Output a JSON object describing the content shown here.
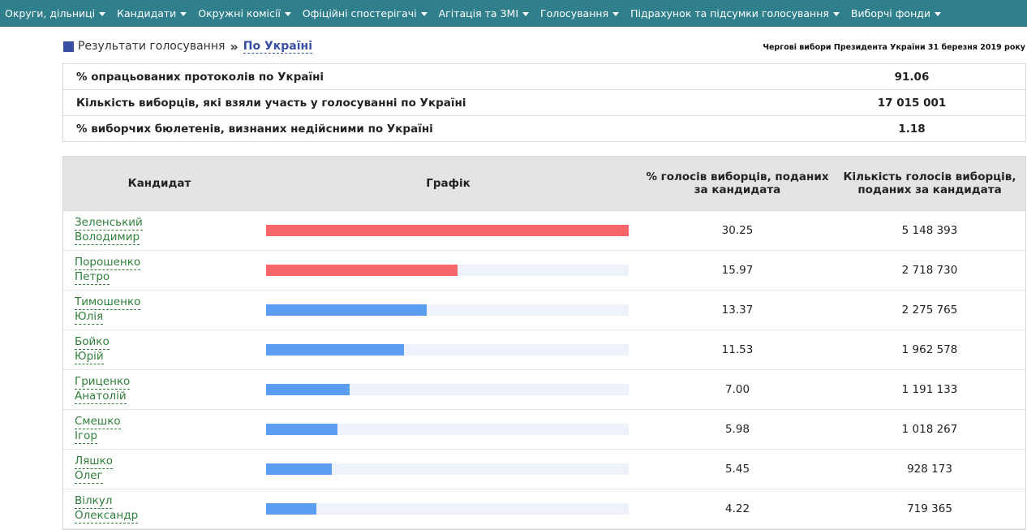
{
  "nav": [
    "Округи, дільниці",
    "Кандидати",
    "Окружні комісії",
    "Офіційні спостерігачі",
    "Агітація та ЗМІ",
    "Голосування",
    "Підрахунок та підсумки голосування",
    "Виборчі фонди"
  ],
  "breadcrumb": {
    "section": "Результати голосування",
    "separator": "»",
    "current": "По Україні"
  },
  "election_title": "Чергові вибори Президента України 31 березня 2019 року",
  "summary": [
    {
      "label": "% опрацьованих протоколів по Україні",
      "value": "91.06"
    },
    {
      "label": "Кількість виборців, які взяли участь у голосуванні по Україні",
      "value": "17 015 001"
    },
    {
      "label": "% виборчих бюлетенів, визнаних недійсними по Україні",
      "value": "1.18"
    }
  ],
  "table": {
    "headers": {
      "candidate": "Кандидат",
      "chart": "Графік",
      "pct": "% голосів виборців, поданих за кандидата",
      "votes": "Кількість голосів виборців, поданих за кандидата"
    },
    "rows": [
      {
        "surname": "Зеленський",
        "name": "Володимир",
        "pct": "30.25",
        "votes": "5 148 393",
        "share": 30.25
      },
      {
        "surname": "Порошенко",
        "name": "Петро",
        "pct": "15.97",
        "votes": "2 718 730",
        "share": 15.97
      },
      {
        "surname": "Тимошенко",
        "name": "Юлія",
        "pct": "13.37",
        "votes": "2 275 765",
        "share": 13.37
      },
      {
        "surname": "Бойко",
        "name": "Юрій",
        "pct": "11.53",
        "votes": "1 962 578",
        "share": 11.53
      },
      {
        "surname": "Гриценко",
        "name": "Анатолій",
        "pct": "7.00",
        "votes": "1 191 133",
        "share": 7.0
      },
      {
        "surname": "Смешко",
        "name": "Ігор",
        "pct": "5.98",
        "votes": "1 018 267",
        "share": 5.98
      },
      {
        "surname": "Ляшко",
        "name": "Олег",
        "pct": "5.45",
        "votes": "928 173",
        "share": 5.45
      },
      {
        "surname": "Вілкул",
        "name": "Олександр",
        "pct": "4.22",
        "votes": "719 365",
        "share": 4.22
      }
    ]
  },
  "colors": {
    "nav_bg": "#2f7f8c",
    "top_two_bar": "#f7666a",
    "other_bar": "#5b9df0",
    "bar_track": "#eef3fb",
    "candidate_link": "#2f7f3a"
  }
}
